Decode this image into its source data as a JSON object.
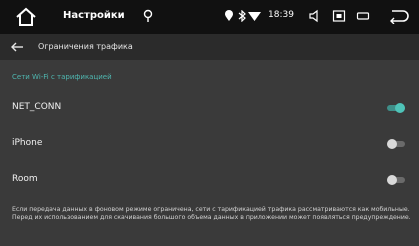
{
  "topbar": {
    "title": "Настройки",
    "time": "18:39"
  },
  "appbar": {
    "title": "Ограничения трафика"
  },
  "section": {
    "title": "Сети Wi-Fi с тарификацией"
  },
  "networks": [
    {
      "name": "NET_CONN",
      "metered": true
    },
    {
      "name": "iPhone",
      "metered": false
    },
    {
      "name": "Room",
      "metered": false
    }
  ],
  "footer": {
    "text": "Если передача данных в фоновом режиме ограничена, сети с тарификацией трафика рассматриваются как мобильные. Перед их использованием для скачивания большого объема данных в приложении может появляться предупреждение."
  },
  "colors": {
    "accent": "#4fc3b8",
    "section_header": "#4fb7b0",
    "topbar": "#111111",
    "appbar": "#2b2b2b",
    "background": "#3a3a3a"
  }
}
